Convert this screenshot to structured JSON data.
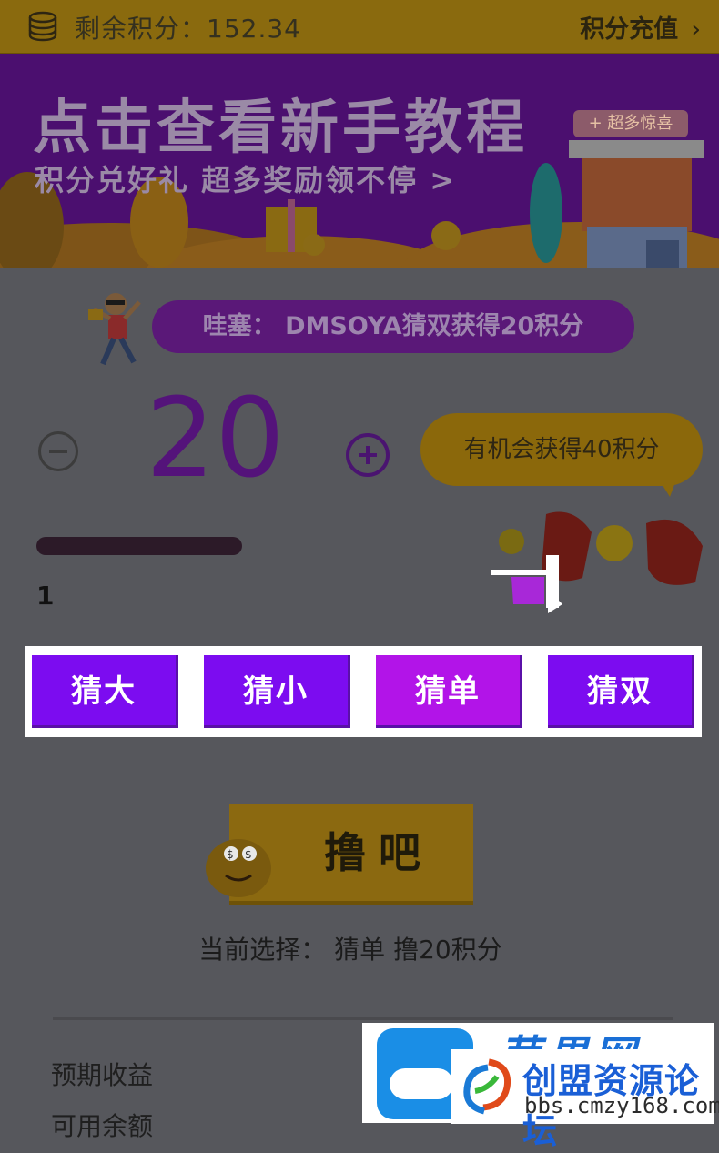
{
  "topbar": {
    "balance_label": "剩余积分：152.34",
    "recharge_label": "积分充值",
    "chevron": "›",
    "icon": "coin-stack-icon"
  },
  "banner": {
    "title": "点击查看新手教程",
    "subtitle": "积分兑好礼 超多奖励领不停 >",
    "shop_tag": "+ 超多惊喜"
  },
  "notice": {
    "text": "哇塞： DMSOYA猜双获得20积分"
  },
  "bet": {
    "amount": "20",
    "chance_text": "有机会获得40积分",
    "slider_value": "1",
    "slider_fraction": 0.05
  },
  "choices": [
    {
      "label": "猜大",
      "selected": false
    },
    {
      "label": "猜小",
      "selected": false
    },
    {
      "label": "猜单",
      "selected": true
    },
    {
      "label": "猜双",
      "selected": false
    }
  ],
  "go_button": {
    "label": "撸吧"
  },
  "current_selection": {
    "text": "当前选择：  猜单  撸20积分"
  },
  "summary": {
    "expected_label": "预期收益",
    "available_label": "可用余额"
  },
  "watermark": {
    "blue_text": "苹果网",
    "site_name": "创盟资源论坛",
    "site_url": "bbs.cmzy168.com"
  },
  "colors": {
    "choice_purple": "#7c0cf0",
    "choice_selected": "#b214e8",
    "gold": "#8b6910",
    "banner_purple": "#4b0f6f"
  }
}
